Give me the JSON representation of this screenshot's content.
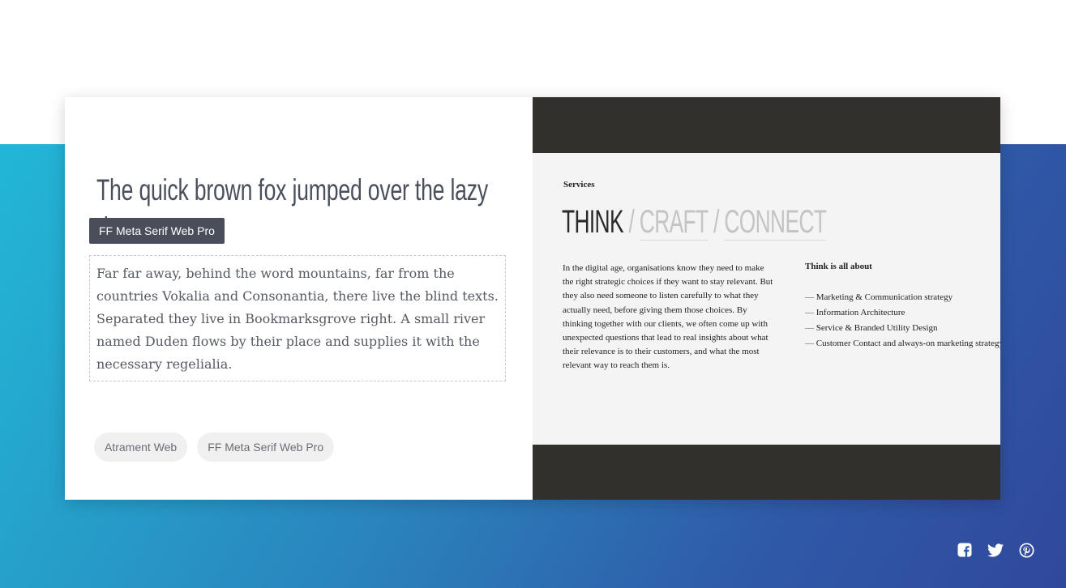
{
  "left_panel": {
    "headline": "The quick brown fox jumped over the lazy dog.",
    "tooltip": "FF Meta Serif Web Pro",
    "body_text": "Far far away, behind the word mountains, far from the countries Vokalia and Consonantia, there live the blind texts. Separated they live in Bookmarksgrove right. A small river named Duden flows by their place and supplies it with the necessary regelialia.",
    "font_pills": [
      "Atrament Web",
      "FF Meta Serif Web Pro"
    ]
  },
  "preview": {
    "section_label": "Services",
    "nav": {
      "active": "THINK",
      "sep": "/",
      "items": [
        "CRAFT",
        "CONNECT"
      ]
    },
    "paragraph": "In the digital age, organisations know they need to make the right strategic choices if they want to stay relevant. But they also need someone to listen carefully to what they actually need, before giving them those choices. By thinking together with our clients, we often come up with unexpected questions that lead to real insights about what their relevance is to their customers, and what the most relevant way to reach them is.",
    "side_title": "Think is all about",
    "list": [
      "Marketing & Communication strategy",
      "Information Architecture",
      "Service & Branded Utility Design",
      "Customer Contact and always-on marketing strategy"
    ]
  },
  "social": [
    "facebook-icon",
    "twitter-icon",
    "pinterest-icon"
  ],
  "colors": {
    "gradient_start": "#22b7d6",
    "gradient_end": "#30489c",
    "preview_dark": "#31302c",
    "tooltip_bg": "#4a4e5a"
  }
}
